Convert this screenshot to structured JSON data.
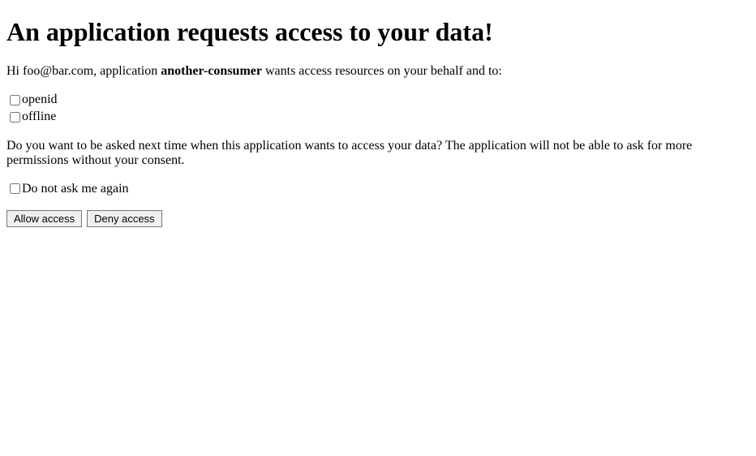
{
  "heading": "An application requests access to your data!",
  "intro": {
    "greeting": "Hi ",
    "user_email": "foo@bar.com",
    "mid1": ", application ",
    "app_name": "another-consumer",
    "mid2": " wants access resources on your behalf and to:"
  },
  "scopes": [
    {
      "label": "openid"
    },
    {
      "label": "offline"
    }
  ],
  "remember_prompt": "Do you want to be asked next time when this application wants to access your data? The application will not be able to ask for more permissions without your consent.",
  "remember_checkbox_label": "Do not ask me again",
  "buttons": {
    "allow": "Allow access",
    "deny": "Deny access"
  }
}
